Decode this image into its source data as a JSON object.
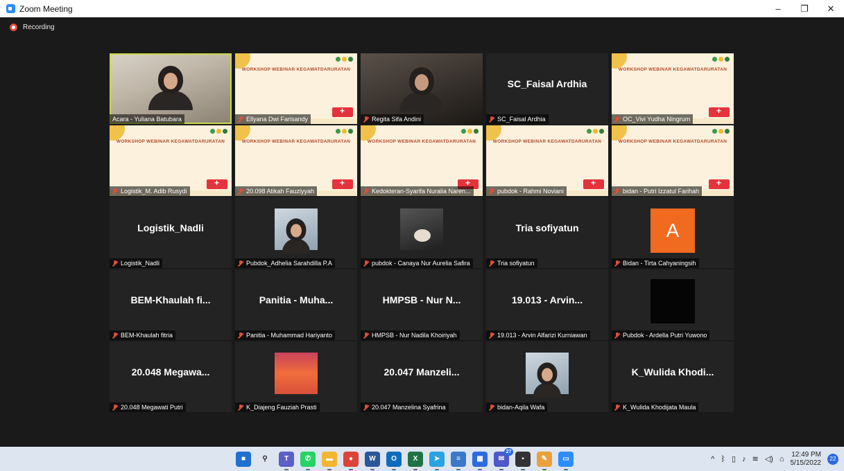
{
  "window": {
    "title": "Zoom Meeting",
    "controls": [
      "–",
      "❐",
      "✕"
    ]
  },
  "recording": {
    "label": "Recording"
  },
  "participants": [
    {
      "label": "Acara - Yuliana Batubara",
      "muted": false,
      "view": "camera",
      "active": true
    },
    {
      "label": "Ellyana Dwi Farisandy",
      "muted": true,
      "view": "slide",
      "banner": "WORKSHOP WEBINAR KEGAWATDARURATAN"
    },
    {
      "label": "Regita Sifa Andini",
      "muted": true,
      "view": "camera-dark"
    },
    {
      "label": "SC_Faisal Ardhia",
      "muted": true,
      "view": "name",
      "display_name": "SC_Faisal Ardhia"
    },
    {
      "label": "OC_Vivi Yudha Ningrum",
      "muted": true,
      "view": "slide",
      "banner": "WORKSHOP WEBINAR KEGAWATDARURATAN"
    },
    {
      "label": "Logistik_M. Adib Rusydi",
      "muted": true,
      "view": "slide",
      "banner": "WORKSHOP WEBINAR KEGAWATDARURATAN"
    },
    {
      "label": "20.098 Atikah Fauziyyah",
      "muted": true,
      "view": "slide",
      "banner": "WORKSHOP WEBINAR KEGAWATDARURATAN"
    },
    {
      "label": "Kedokteran-Syarifa Nuralia Naren...",
      "muted": true,
      "view": "slide",
      "banner": "WORKSHOP WEBINAR KEGAWATDARURATAN"
    },
    {
      "label": "pubdok - Rahmi Noviani",
      "muted": true,
      "view": "slide",
      "banner": "WORKSHOP WEBINAR KEGAWATDARURATAN"
    },
    {
      "label": "bidan - Putri Izzatul Farihah",
      "muted": true,
      "view": "slide",
      "banner": "WORKSHOP WEBINAR KEGAWATDARURATAN"
    },
    {
      "label": "Logistik_Nadli",
      "muted": true,
      "view": "name",
      "display_name": "Logistik_Nadli"
    },
    {
      "label": "Pubdok_Adhelia Sarahdilla P.A",
      "muted": true,
      "view": "photo"
    },
    {
      "label": "pubdok - Canaya Nur Aurelia Safira",
      "muted": true,
      "view": "photo-dark"
    },
    {
      "label": "Tria sofiyatun",
      "muted": true,
      "view": "name",
      "display_name": "Tria sofiyatun"
    },
    {
      "label": "Bidan - Tirta Cahyaningsih",
      "muted": true,
      "view": "avatar",
      "initial": "A"
    },
    {
      "label": "BEM-Khaulah fitria",
      "muted": true,
      "view": "name",
      "display_name": "BEM-Khaulah fi..."
    },
    {
      "label": "Panitia - Muhammad Hariyanto",
      "muted": true,
      "view": "name",
      "display_name": "Panitia - Muha..."
    },
    {
      "label": "HMPSB - Nur Nadila Khoiriyah",
      "muted": true,
      "view": "name",
      "display_name": "HMPSB - Nur N..."
    },
    {
      "label": "19.013 - Arvin Alfarizi Kurniawan",
      "muted": true,
      "view": "name",
      "display_name": "19.013 - Arvin..."
    },
    {
      "label": "Pubdok - Ardella Putri Yuwono",
      "muted": true,
      "view": "black"
    },
    {
      "label": "20.048 Megawati Putri",
      "muted": true,
      "view": "name",
      "display_name": "20.048 Megawa..."
    },
    {
      "label": "K_Diajeng Fauziah Prasti",
      "muted": true,
      "view": "sunset"
    },
    {
      "label": "20.047 Manzelina Syafrina",
      "muted": true,
      "view": "name",
      "display_name": "20.047 Manzeli..."
    },
    {
      "label": "bidan-Aqila Wafa",
      "muted": true,
      "view": "photo"
    },
    {
      "label": "K_Wulida Khodijata Maula",
      "muted": true,
      "view": "name",
      "display_name": "K_Wulida Khodi..."
    }
  ],
  "taskbar": {
    "apps": [
      {
        "name": "start",
        "color": "#1f6fd1",
        "glyph": "■"
      },
      {
        "name": "search",
        "color": "#dde5f0",
        "glyph": "⚲"
      },
      {
        "name": "teams",
        "color": "#5b5fc7",
        "glyph": "T"
      },
      {
        "name": "whatsapp",
        "color": "#25d366",
        "glyph": "✆"
      },
      {
        "name": "file-explorer",
        "color": "#f2b632",
        "glyph": "▬"
      },
      {
        "name": "chrome",
        "color": "#db4437",
        "glyph": "●"
      },
      {
        "name": "word",
        "color": "#2b579a",
        "glyph": "W"
      },
      {
        "name": "outlook",
        "color": "#0f6cbd",
        "glyph": "O"
      },
      {
        "name": "excel",
        "color": "#217346",
        "glyph": "X"
      },
      {
        "name": "telegram",
        "color": "#2aa3e0",
        "glyph": "➤"
      },
      {
        "name": "notepad",
        "color": "#3a78c8",
        "glyph": "≡"
      },
      {
        "name": "calculator",
        "color": "#2d6adf",
        "glyph": "▦"
      },
      {
        "name": "teams-chat",
        "color": "#4e58c9",
        "glyph": "✉",
        "badge": "27"
      },
      {
        "name": "sticky-notes",
        "color": "#333333",
        "glyph": "▪"
      },
      {
        "name": "paint",
        "color": "#e9a23b",
        "glyph": "✎"
      },
      {
        "name": "zoom",
        "color": "#2d8cff",
        "glyph": "▭"
      }
    ],
    "tray": {
      "chevron": "^",
      "time": "12:49 PM",
      "date": "5/15/2022",
      "notifications": "22"
    }
  }
}
